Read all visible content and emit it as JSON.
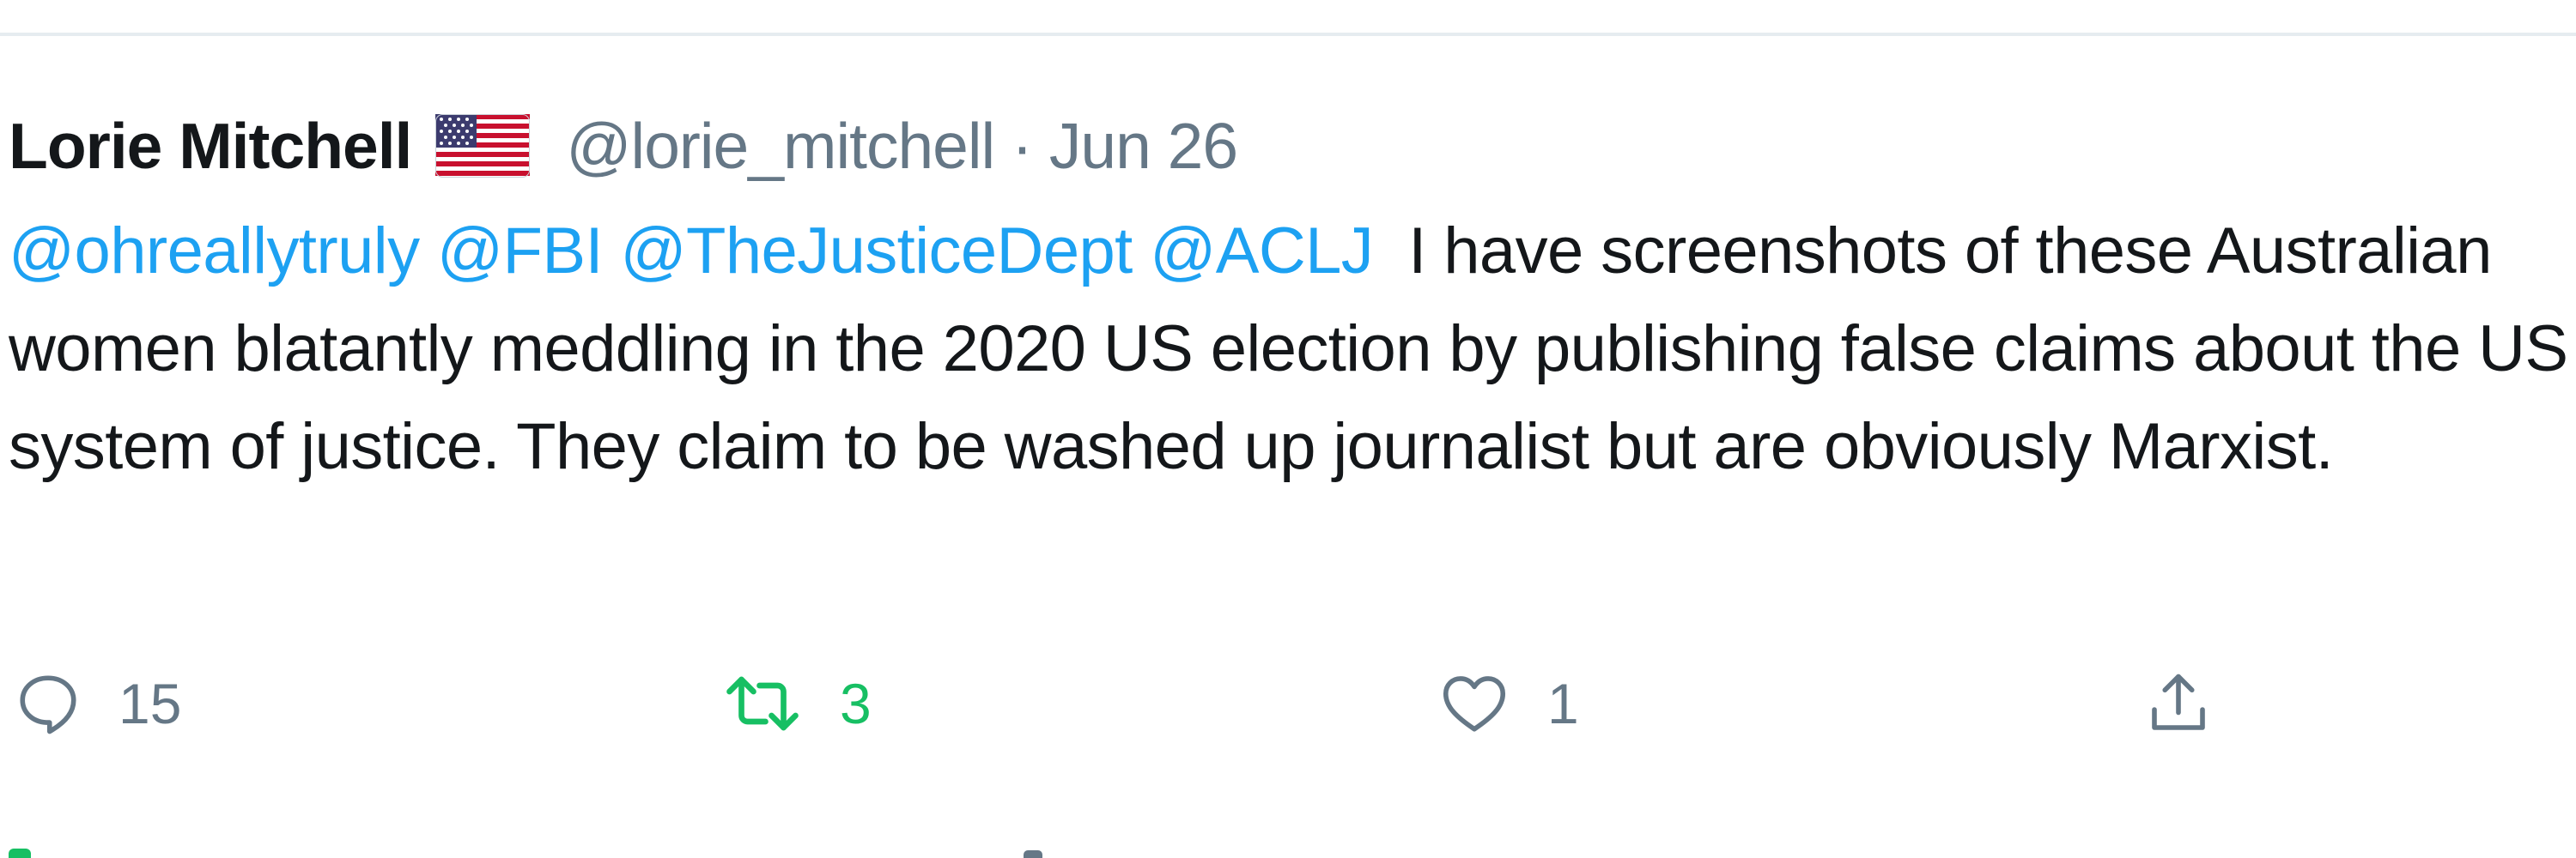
{
  "tweet": {
    "author_name": "Lorie Mitchell",
    "author_flag_icon": "us-flag-icon",
    "handle": "@lorie_mitchell",
    "separator": "·",
    "date": "Jun 26",
    "mentions": [
      "@ohreallytruly",
      "@FBI",
      "@TheJusticeDept",
      "@ACLJ"
    ],
    "text": "I have screenshots of these Australian women blatantly meddling in the 2020 US election by publishing false claims about the US system of justice. They claim to be washed up journalist but are obviously Marxist."
  },
  "actions": {
    "reply_icon": "reply-icon",
    "reply_count": "15",
    "retweet_icon": "retweet-icon",
    "retweet_count": "3",
    "like_icon": "like-icon",
    "like_count": "1",
    "share_icon": "share-icon"
  },
  "colors": {
    "text": "#14171a",
    "secondary": "#657786",
    "mention": "#1da1f2",
    "retweet_active": "#17bf63",
    "divider": "#e6ecf0"
  }
}
